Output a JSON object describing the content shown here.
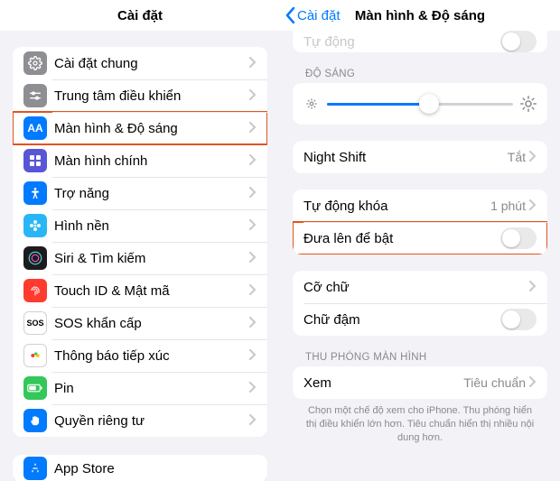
{
  "left": {
    "title": "Cài đặt",
    "items": [
      {
        "label": "Cài đặt chung",
        "icon": "gear-icon",
        "bg": "bg-gray"
      },
      {
        "label": "Trung tâm điều khiển",
        "icon": "switches-icon",
        "bg": "bg-gray"
      },
      {
        "label": "Màn hình & Độ sáng",
        "icon": "aa-icon",
        "bg": "bg-blue",
        "selected": true,
        "glyph": "AA"
      },
      {
        "label": "Màn hình chính",
        "icon": "grid-icon",
        "bg": "bg-indigo"
      },
      {
        "label": "Trợ năng",
        "icon": "accessibility-icon",
        "bg": "bg-blue"
      },
      {
        "label": "Hình nền",
        "icon": "flower-icon",
        "bg": "bg-cyan"
      },
      {
        "label": "Siri & Tìm kiếm",
        "icon": "siri-icon",
        "bg": "bg-black"
      },
      {
        "label": "Touch ID & Mật mã",
        "icon": "fingerprint-icon",
        "bg": "bg-red"
      },
      {
        "label": "SOS khẩn cấp",
        "icon": "sos-icon",
        "bg": "bg-white",
        "glyph": "SOS"
      },
      {
        "label": "Thông báo tiếp xúc",
        "icon": "exposure-icon",
        "bg": "bg-white"
      },
      {
        "label": "Pin",
        "icon": "battery-icon",
        "bg": "bg-green"
      },
      {
        "label": "Quyền riêng tư",
        "icon": "hand-icon",
        "bg": "bg-blue"
      }
    ],
    "next_group_first": "App Store"
  },
  "right": {
    "back": "Cài đặt",
    "title": "Màn hình & Độ sáng",
    "peek_top_label": "Tự động",
    "brightness_header": "ĐỘ SÁNG",
    "brightness_pct": 55,
    "night_shift": {
      "label": "Night Shift",
      "value": "Tắt"
    },
    "auto_lock": {
      "label": "Tự động khóa",
      "value": "1 phút"
    },
    "raise_wake": {
      "label": "Đưa lên để bật",
      "on": false,
      "highlight": true
    },
    "text_size": {
      "label": "Cỡ chữ"
    },
    "bold_text": {
      "label": "Chữ đậm",
      "on": false
    },
    "zoom_header": "THU PHÓNG MÀN HÌNH",
    "zoom_view": {
      "label": "Xem",
      "value": "Tiêu chuẩn"
    },
    "zoom_footer": "Chọn một chế độ xem cho iPhone. Thu phóng hiển thị điều khiển lớn hơn. Tiêu chuẩn hiển thị nhiều nội dung hơn."
  }
}
